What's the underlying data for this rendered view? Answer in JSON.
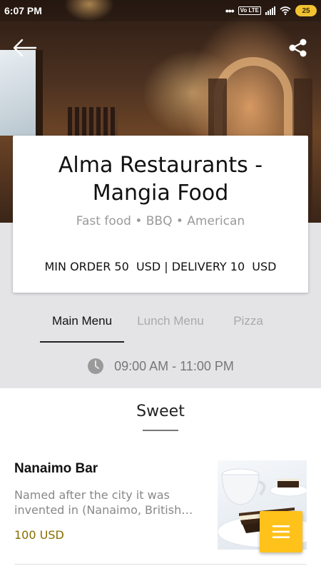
{
  "status_bar": {
    "time": "6:07 PM",
    "network": "Vo LTE",
    "battery": "25"
  },
  "header": {
    "back_icon": "arrow-left-icon",
    "share_icon": "share-icon"
  },
  "restaurant": {
    "name": "Alma Restaurants - Mangia Food",
    "cuisine": "Fast food • BBQ • American",
    "order_info": "MIN ORDER 50  USD | DELIVERY 10  USD"
  },
  "tabs": [
    {
      "label": "Main Menu",
      "active": true
    },
    {
      "label": "Lunch Menu",
      "active": false
    },
    {
      "label": "Pizza",
      "active": false
    }
  ],
  "hours": {
    "icon": "clock-icon",
    "text": "09:00 AM - 11:00 PM"
  },
  "section": {
    "title": "Sweet"
  },
  "menu_items": [
    {
      "name": "Nanaimo Bar",
      "description": "Named after the city it was invented in (Nanaimo, British Columbia)",
      "price": "100 USD"
    }
  ],
  "fab": {
    "icon": "menu-icon"
  },
  "colors": {
    "accent": "#ffc21a",
    "price": "#8a6d00",
    "band": "#e4e4e6"
  }
}
